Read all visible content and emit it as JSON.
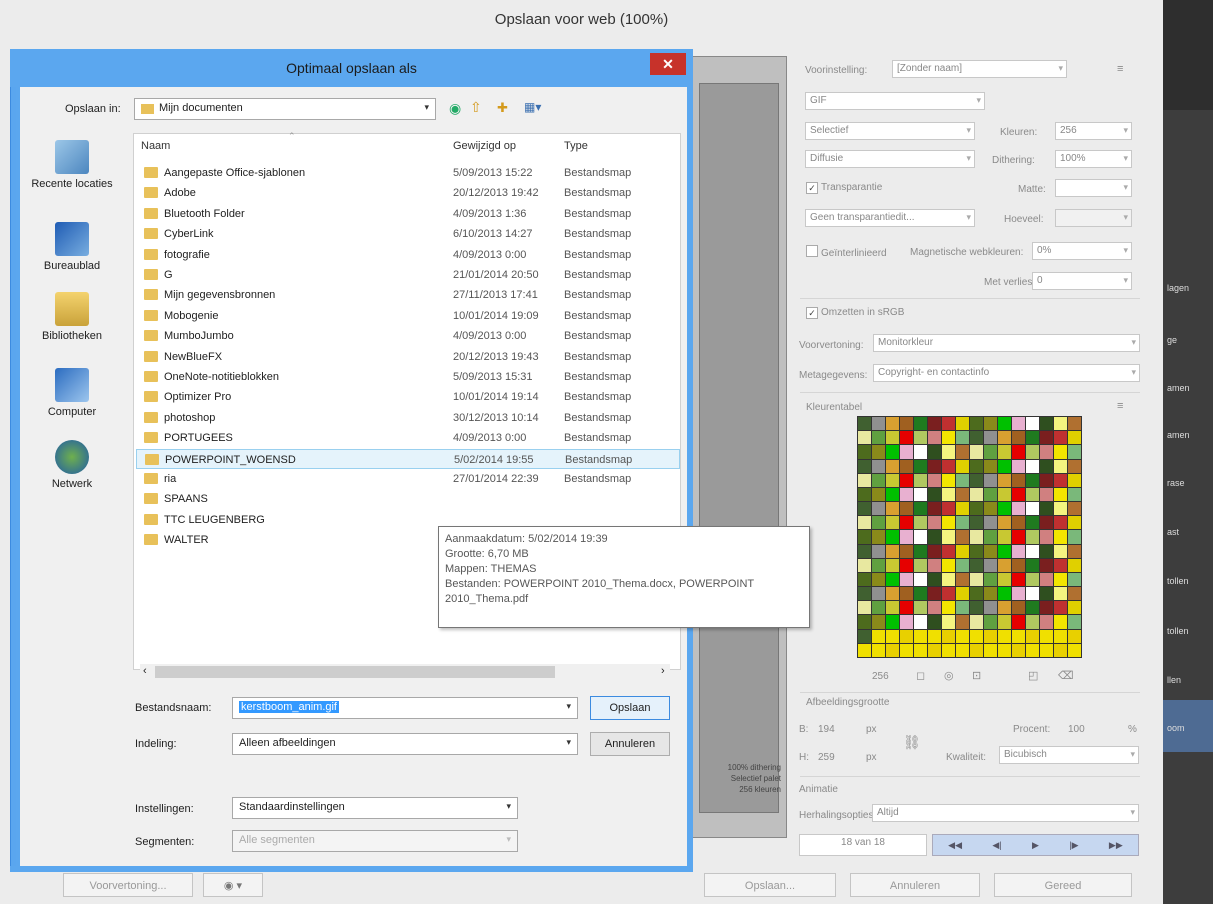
{
  "window": {
    "title": "Opslaan voor web (100%)"
  },
  "right_panel": {
    "preset_label": "Voorinstelling:",
    "preset_value": "[Zonder naam]",
    "format": "GIF",
    "reduction": "Selectief",
    "colors_label": "Kleuren:",
    "colors_value": "256",
    "dither_algo": "Diffusie",
    "dither_label": "Dithering:",
    "dither_value": "100%",
    "transparency_label": "Transparantie",
    "transparency_checked": true,
    "matte_label": "Matte:",
    "transp_dither": "Geen transparantiedit...",
    "amount_label": "Hoeveel:",
    "interlaced_label": "Geïnterlinieerd",
    "web_snap_label": "Magnetische webkleuren:",
    "web_snap_value": "0%",
    "lossy_label": "Met verlies:",
    "lossy_value": "0",
    "srgb_label": "Omzetten in sRGB",
    "srgb_checked": true,
    "preview_label": "Voorvertoning:",
    "preview_value": "Monitorkleur",
    "metadata_label": "Metagegevens:",
    "metadata_value": "Copyright- en contactinfo",
    "color_table_label": "Kleurentabel",
    "color_count": "256",
    "image_size_label": "Afbeeldingsgrootte",
    "w_label": "B:",
    "w_value": "194",
    "h_label": "H:",
    "h_value": "259",
    "unit": "px",
    "percent_label": "Procent:",
    "percent_value": "100",
    "percent_unit": "%",
    "quality_label": "Kwaliteit:",
    "quality_value": "Bicubisch",
    "animation_label": "Animatie",
    "loop_label": "Herhalingsopties:",
    "loop_value": "Altijd",
    "frame_counter": "18 van 18",
    "preview_info": [
      "100% dithering",
      "Selectief palet",
      "256 kleuren"
    ]
  },
  "bottom_buttons": {
    "preview": "Voorvertoning...",
    "save": "Opslaan...",
    "cancel": "Annuleren",
    "done": "Gereed"
  },
  "right_strip_labels": [
    "lagen",
    "ge",
    "amen",
    "amen",
    "rase",
    "ast",
    "tollen",
    "tollen",
    "llen",
    "oom"
  ],
  "dialog": {
    "title": "Optimaal opslaan als",
    "save_in_label": "Opslaan in:",
    "save_in_value": "Mijn documenten",
    "places": [
      "Recente locaties",
      "Bureaublad",
      "Bibliotheken",
      "Computer",
      "Netwerk"
    ],
    "columns": {
      "name": "Naam",
      "date": "Gewijzigd op",
      "type": "Type"
    },
    "files": [
      {
        "name": "Aangepaste Office-sjablonen",
        "date": "5/09/2013 15:22",
        "type": "Bestandsmap"
      },
      {
        "name": "Adobe",
        "date": "20/12/2013 19:42",
        "type": "Bestandsmap"
      },
      {
        "name": "Bluetooth Folder",
        "date": "4/09/2013 1:36",
        "type": "Bestandsmap"
      },
      {
        "name": "CyberLink",
        "date": "6/10/2013 14:27",
        "type": "Bestandsmap"
      },
      {
        "name": "fotografie",
        "date": "4/09/2013 0:00",
        "type": "Bestandsmap"
      },
      {
        "name": "G",
        "date": "21/01/2014 20:50",
        "type": "Bestandsmap"
      },
      {
        "name": "Mijn gegevensbronnen",
        "date": "27/11/2013 17:41",
        "type": "Bestandsmap"
      },
      {
        "name": "Mobogenie",
        "date": "10/01/2014 19:09",
        "type": "Bestandsmap"
      },
      {
        "name": "MumboJumbo",
        "date": "4/09/2013 0:00",
        "type": "Bestandsmap"
      },
      {
        "name": "NewBlueFX",
        "date": "20/12/2013 19:43",
        "type": "Bestandsmap"
      },
      {
        "name": "OneNote-notitieblokken",
        "date": "5/09/2013 15:31",
        "type": "Bestandsmap"
      },
      {
        "name": "Optimizer Pro",
        "date": "10/01/2014 19:14",
        "type": "Bestandsmap"
      },
      {
        "name": "photoshop",
        "date": "30/12/2013 10:14",
        "type": "Bestandsmap"
      },
      {
        "name": "PORTUGEES",
        "date": "4/09/2013 0:00",
        "type": "Bestandsmap"
      },
      {
        "name": "POWERPOINT_WOENSD",
        "date": "5/02/2014 19:55",
        "type": "Bestandsmap"
      },
      {
        "name": "ria",
        "date": "27/01/2014 22:39",
        "type": "Bestandsmap"
      },
      {
        "name": "SPAANS",
        "date": "",
        "type": ""
      },
      {
        "name": "TTC LEUGENBERG",
        "date": "",
        "type": ""
      },
      {
        "name": "WALTER",
        "date": "",
        "type": ""
      }
    ],
    "tooltip": [
      "Aanmaakdatum: 5/02/2014 19:39",
      "Grootte: 6,70 MB",
      "Mappen: THEMAS",
      "Bestanden: POWERPOINT 2010_Thema.docx, POWERPOINT",
      "2010_Thema.pdf"
    ],
    "filename_label": "Bestandsnaam:",
    "filename_value": "kerstboom_anim.gif",
    "format_label": "Indeling:",
    "format_value": "Alleen afbeeldingen",
    "settings_label": "Instellingen:",
    "settings_value": "Standaardinstellingen",
    "slices_label": "Segmenten:",
    "slices_value": "Alle segmenten",
    "save_button": "Opslaan",
    "cancel_button": "Annuleren",
    "close_icon": "close-icon"
  },
  "colors": {
    "accent": "#5ba7ef",
    "close": "#c7322a",
    "folder": "#e8c15a",
    "selection": "#e5f3fb"
  }
}
